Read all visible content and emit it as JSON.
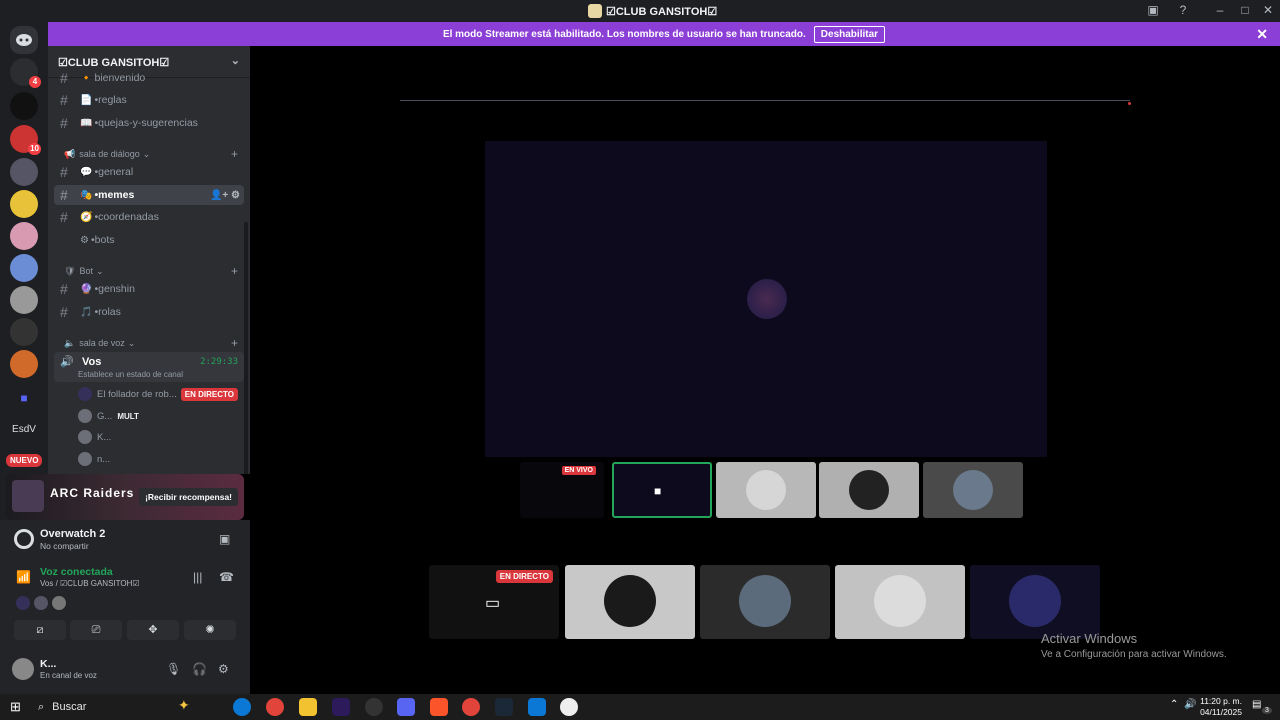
{
  "window": {
    "title": "☑CLUB GANSITOH☑"
  },
  "banner": {
    "message": "El modo Streamer está habilitado. Los nombres de usuario se han truncado.",
    "disable_label": "Deshabilitar",
    "close_icon": "✕"
  },
  "rail": {
    "mentions_badge": "4",
    "server_badge_1": "10",
    "server_label": "EsdV",
    "new_label": "NUEVO"
  },
  "guild": {
    "name": "☑CLUB GANSITOH☑",
    "channels": [
      {
        "emoji": "🔸",
        "name": "bienvenido"
      },
      {
        "emoji": "📄",
        "name": "•reglas"
      },
      {
        "emoji": "📖",
        "name": "•quejas-y-sugerencias"
      }
    ],
    "category_dialogo": "sala de diálogo",
    "dialogo_channels": [
      {
        "emoji": "💬",
        "name": "•general"
      },
      {
        "emoji": "🎭",
        "name": "•memes"
      },
      {
        "emoji": "🧭",
        "name": "•coordenadas"
      },
      {
        "emoji": "⚙",
        "name": "•bots"
      }
    ],
    "category_bot": "Bot",
    "bot_channels": [
      {
        "emoji": "🔮",
        "name": "•genshin"
      },
      {
        "emoji": "🎵",
        "name": "•rolas"
      }
    ],
    "category_voz": "sala de voz",
    "voice_channel": {
      "name": "Vos",
      "timer": "2:29:33",
      "status": "Establece un estado de canal"
    },
    "voice_users": [
      {
        "name": "El follador de rob...",
        "tag": "EN DIRECTO"
      },
      {
        "name": "G...",
        "tag": "MULT"
      },
      {
        "name": "K..."
      },
      {
        "name": "n..."
      }
    ]
  },
  "promo": {
    "game": "ARC Raiders",
    "cta": "¡Recibir recompensa!"
  },
  "activity": {
    "game": "Overwatch 2",
    "sub": "No compartir"
  },
  "voice": {
    "title": "Voz conectada",
    "sub": "Vos / ☑CLUB GANSITOH☑"
  },
  "me": {
    "name": "K...",
    "status": "En canal de voz"
  },
  "stage": {
    "thumb_live": "EN VIVO",
    "tile_live": "EN DIRECTO"
  },
  "watermark": {
    "line1": "Activar Windows",
    "line2": "Ve a Configuración para activar Windows."
  },
  "taskbar": {
    "search": "Buscar",
    "time": "11:20 p. m.",
    "date": "04/11/2025",
    "notif_count": "3"
  },
  "colors": {
    "banner": "#8c3fd6",
    "live": "#da373c",
    "connected": "#23a55a"
  }
}
